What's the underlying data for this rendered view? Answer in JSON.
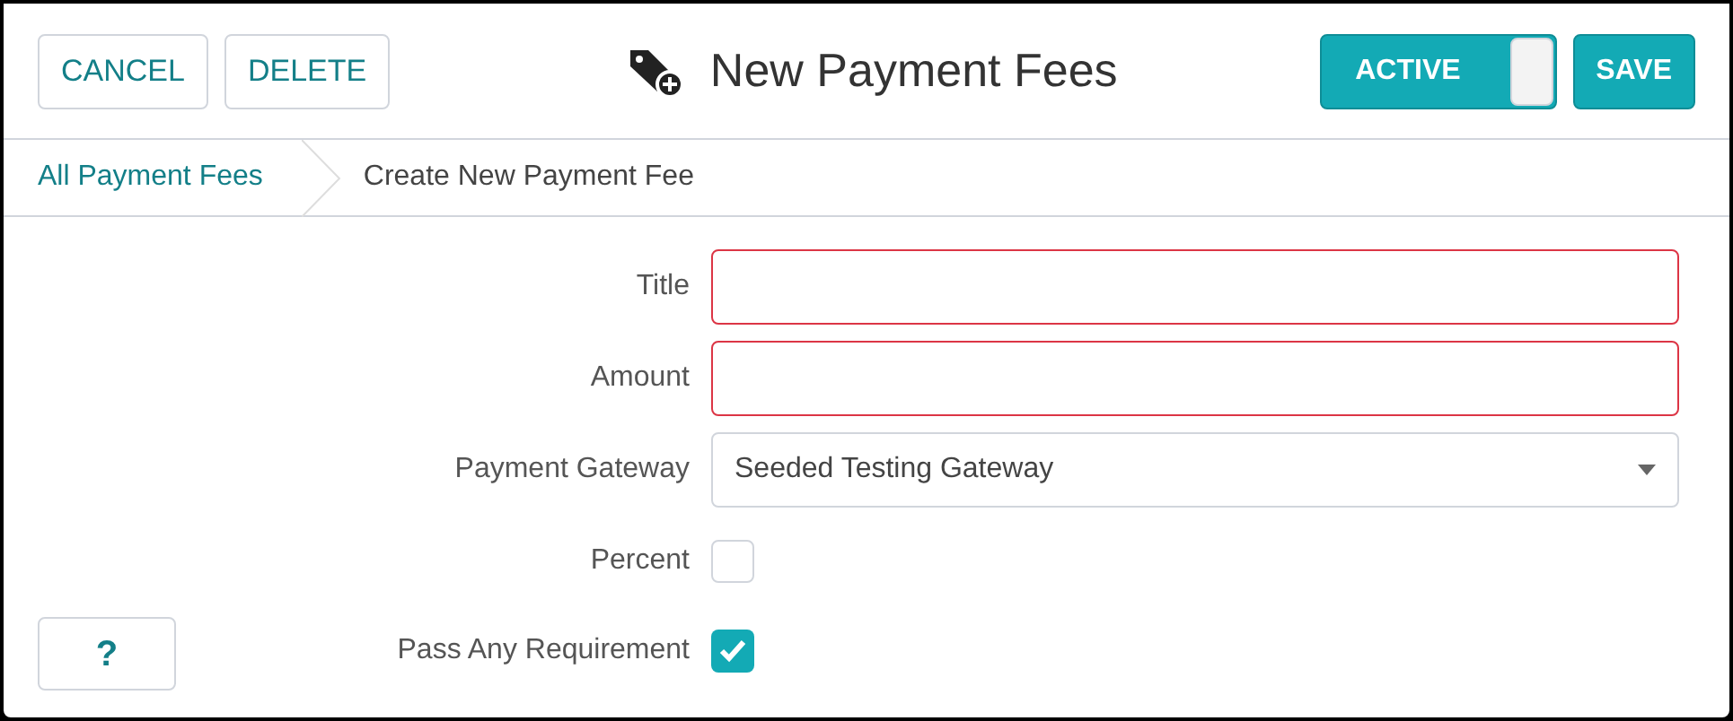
{
  "header": {
    "buttons": [
      "CANCEL",
      "DELETE"
    ],
    "title": "New Payment Fees",
    "active_toggle": {
      "label": "ACTIVE",
      "on": true
    },
    "save_button": "SAVE"
  },
  "breadcrumbs": [
    {
      "label": "All Payment Fees",
      "selected": false
    },
    {
      "label": "Create New Payment Fee",
      "selected": true
    }
  ],
  "fields": [
    {
      "kind": "text",
      "label": "Title",
      "invalid": true
    },
    {
      "kind": "text",
      "label": "Amount",
      "invalid": true
    },
    {
      "kind": "select",
      "label": "Payment Gateway",
      "value": "Seeded Testing Gateway"
    },
    {
      "kind": "checkbox",
      "label": "Percent",
      "checked": false
    },
    {
      "kind": "checkbox",
      "label": "Pass Any Requirement",
      "checked": true
    }
  ],
  "help_button": "?"
}
